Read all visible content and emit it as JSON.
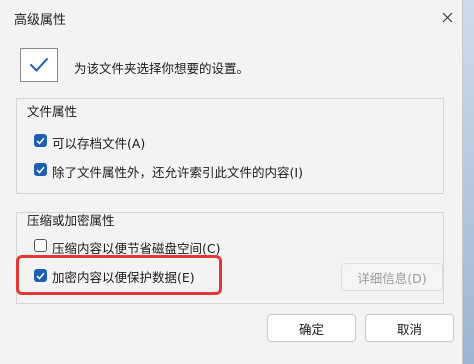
{
  "window": {
    "title": "高级属性"
  },
  "header": {
    "text": "为该文件夹选择你想要的设置。",
    "icon": "checkmark-icon"
  },
  "file_attributes": {
    "title": "文件属性",
    "items": [
      {
        "label": "可以存档文件(A)",
        "checked": true
      },
      {
        "label": "除了文件属性外，还允许索引此文件的内容(I)",
        "checked": true
      }
    ]
  },
  "compress_encrypt": {
    "title": "压缩或加密属性",
    "items": [
      {
        "label": "压缩内容以便节省磁盘空间(C)",
        "checked": false
      },
      {
        "label": "加密内容以便保护数据(E)",
        "checked": true
      }
    ],
    "details_button": "详细信息(D)"
  },
  "buttons": {
    "ok": "确定",
    "cancel": "取消"
  },
  "colors": {
    "accent": "#1f5fb0",
    "highlight": "#e53935"
  }
}
